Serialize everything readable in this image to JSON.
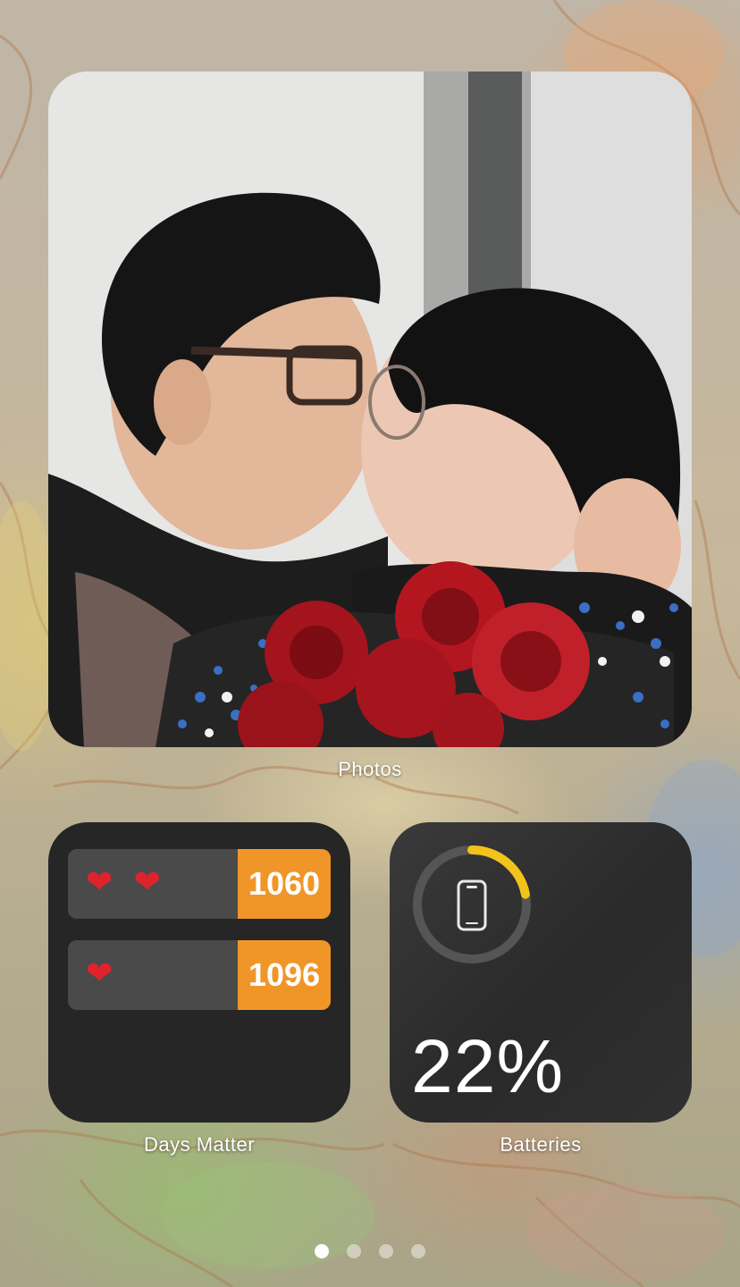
{
  "photos_widget": {
    "label": "Photos"
  },
  "days_matter_widget": {
    "label": "Days Matter",
    "rows": [
      {
        "hearts": "❤ ❤",
        "count": "1060"
      },
      {
        "hearts": "❤",
        "count": "1096"
      }
    ],
    "accent_color": "#f09628",
    "heart_color": "#e0222c"
  },
  "batteries_widget": {
    "label": "Batteries",
    "percent_text": "22%",
    "level": 0.22,
    "ring_color": "#f2c31a",
    "device_icon": "iphone-icon"
  },
  "page_indicator": {
    "total": 4,
    "active": 0
  }
}
